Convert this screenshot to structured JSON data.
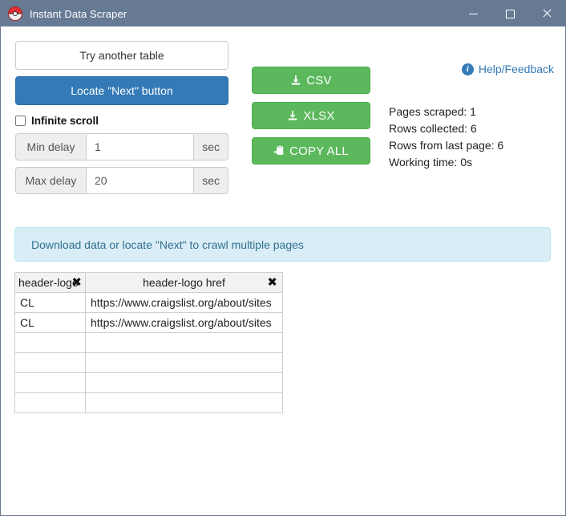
{
  "window": {
    "title": "Instant Data Scraper",
    "icon": "app-logo-icon",
    "minimize_label": "Minimize",
    "maximize_label": "Maximize",
    "close_label": "Close"
  },
  "controls": {
    "try_another_table": "Try another table",
    "locate_next_button": "Locate \"Next\" button",
    "infinite_scroll_label": "Infinite scroll",
    "infinite_scroll_checked": false,
    "min_delay": {
      "label": "Min delay",
      "value": "1",
      "placeholder": "",
      "unit": "sec"
    },
    "max_delay": {
      "label": "Max delay",
      "value": "20",
      "placeholder": "",
      "unit": "sec"
    }
  },
  "actions": {
    "csv": "CSV",
    "xlsx": "XLSX",
    "copy_all": "COPY ALL"
  },
  "help": {
    "label": "Help/Feedback",
    "icon": "info-circle-icon"
  },
  "stats": {
    "pages_scraped": "Pages scraped: 1",
    "rows_collected": "Rows collected: 6",
    "rows_last_page": "Rows from last page: 6",
    "working_time": "Working time: 0s"
  },
  "alert": {
    "message": "Download data or locate \"Next\" to crawl multiple pages"
  },
  "table": {
    "columns": [
      {
        "label": "header-logo",
        "delete_glyph": "✖"
      },
      {
        "label": "header-logo href",
        "delete_glyph": "✖"
      }
    ],
    "rows": [
      {
        "c0": "CL",
        "c1": "https://www.craigslist.org/about/sites"
      },
      {
        "c0": "CL",
        "c1": "https://www.craigslist.org/about/sites"
      },
      {
        "c0": "",
        "c1": ""
      },
      {
        "c0": "",
        "c1": ""
      },
      {
        "c0": "",
        "c1": ""
      },
      {
        "c0": "",
        "c1": ""
      }
    ]
  },
  "colors": {
    "titlebar": "#667a94",
    "primary": "#337ab7",
    "success": "#5cb85c",
    "info_bg": "#d9edf7",
    "info_text": "#31708f"
  }
}
